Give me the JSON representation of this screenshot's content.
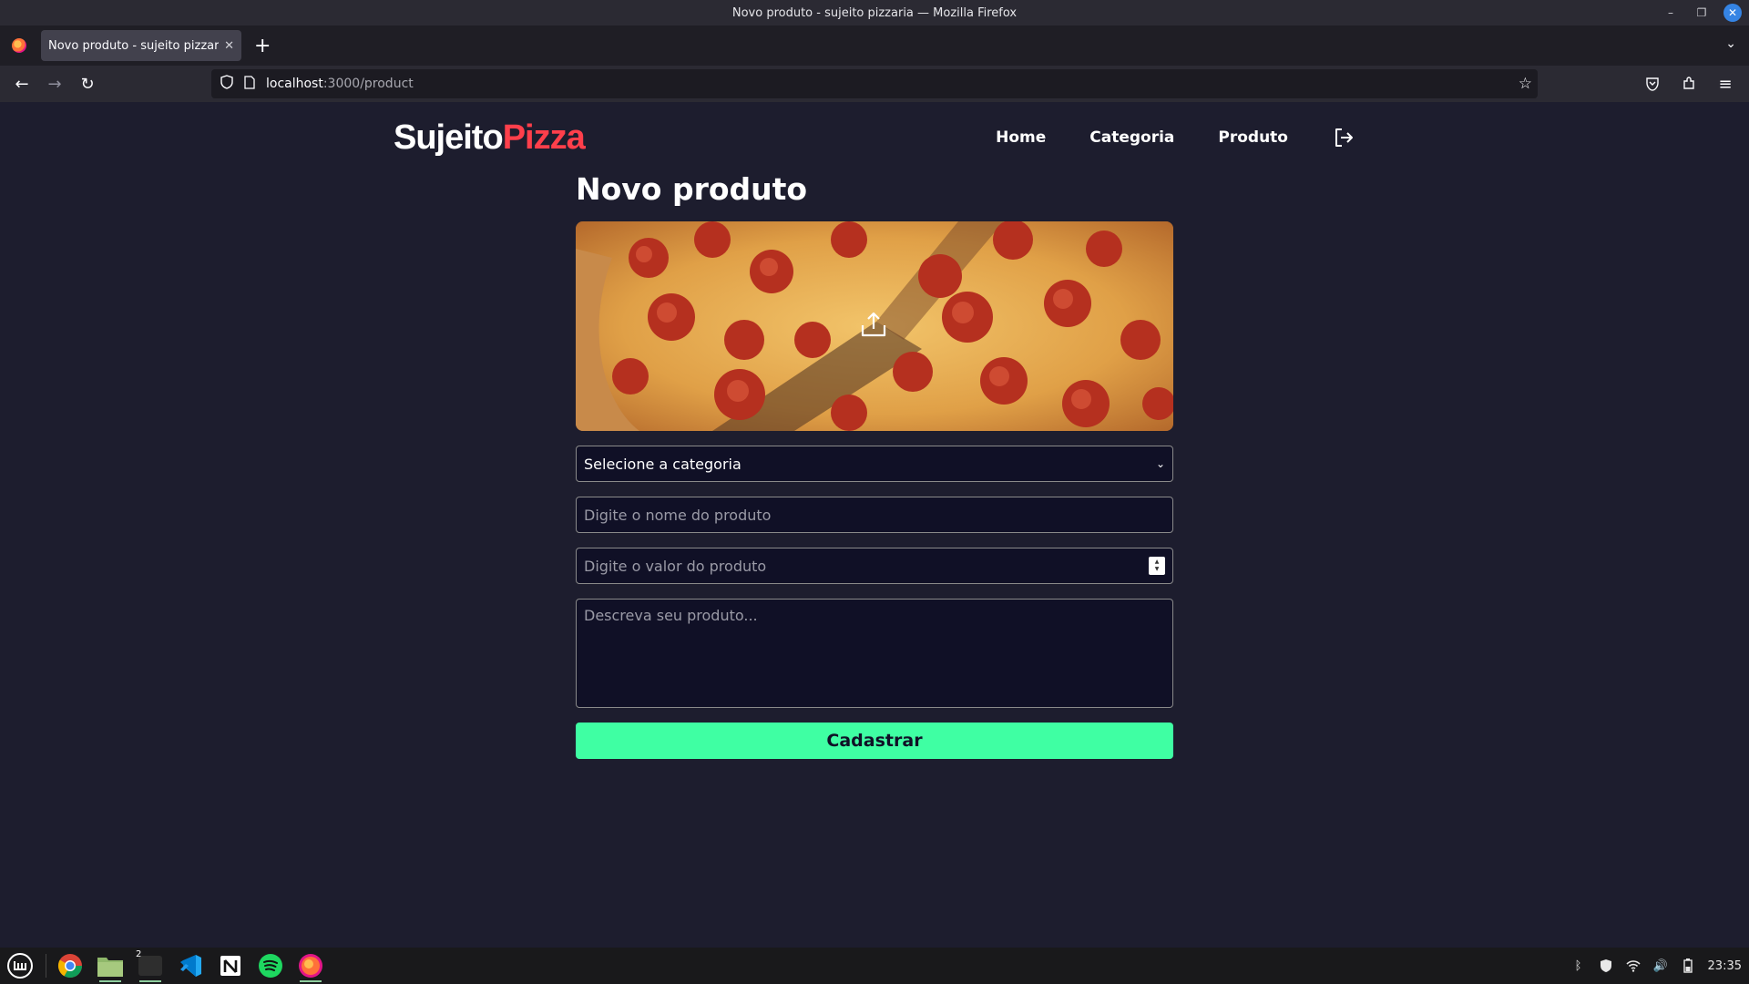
{
  "window": {
    "title": "Novo produto - sujeito pizzaria — Mozilla Firefox"
  },
  "browser": {
    "tab_title": "Novo produto - sujeito pizzaria",
    "url_host": "localhost",
    "url_path": ":3000/product"
  },
  "site": {
    "logo_part1": "Sujeito",
    "logo_part2": "Pizza",
    "nav": {
      "home": "Home",
      "categoria": "Categoria",
      "produto": "Produto"
    }
  },
  "form": {
    "title": "Novo produto",
    "category_selected": "Selecione a categoria",
    "name_placeholder": "Digite o nome do produto",
    "price_placeholder": "Digite o valor do produto",
    "description_placeholder": "Descreva seu produto...",
    "submit_label": "Cadastrar"
  },
  "taskbar": {
    "terminal_badge": "2",
    "clock": "23:35"
  },
  "colors": {
    "page_bg": "#1d1d2e",
    "logo_accent": "#ff3f4b",
    "submit_bg": "#3fffa3",
    "field_bg": "#101026"
  }
}
